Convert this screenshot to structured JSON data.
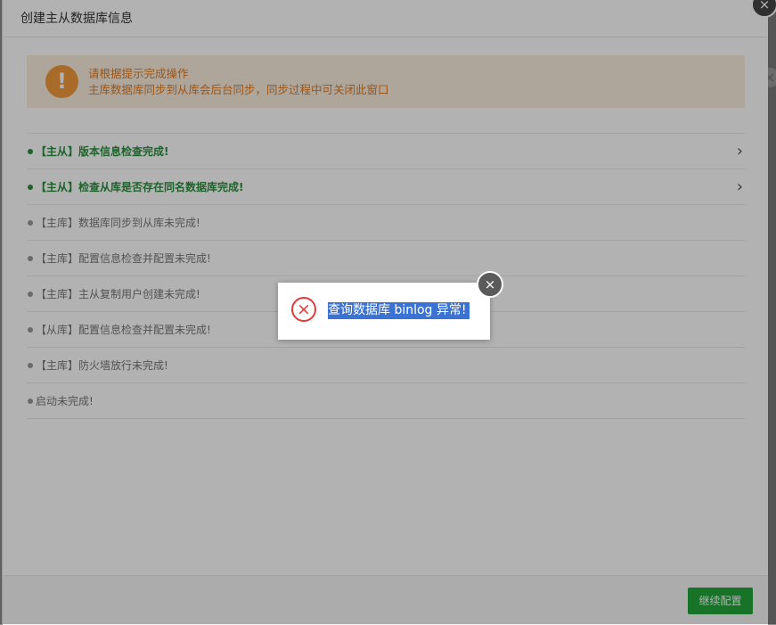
{
  "dialog": {
    "title": "创建主从数据库信息",
    "close_icon": "×"
  },
  "notice": {
    "icon": "!",
    "line1": "请根据提示完成操作",
    "line2": "主库数据库同步到从库会后台同步，同步过程中可关闭此窗口"
  },
  "steps": [
    {
      "text": "【主从】版本信息检查完成!",
      "status": "done",
      "chevron": "›"
    },
    {
      "text": "【主从】检查从库是否存在同名数据库完成!",
      "status": "done",
      "chevron": "›"
    },
    {
      "text": "【主库】数据库同步到从库未完成!",
      "status": "pending"
    },
    {
      "text": "【主库】配置信息检查并配置未完成!",
      "status": "pending"
    },
    {
      "text": "【主库】主从复制用户创建未完成!",
      "status": "pending"
    },
    {
      "text": "【从库】配置信息检查并配置未完成!",
      "status": "pending"
    },
    {
      "text": "【主库】防火墙放行未完成!",
      "status": "pending"
    },
    {
      "text": "启动未完成!",
      "status": "pending"
    }
  ],
  "footer": {
    "continue_label": "继续配置"
  },
  "error_popup": {
    "icon": "×",
    "message": "查询数据库 binlog 异常!",
    "close_icon": "×"
  },
  "colors": {
    "accent": "#20a53a",
    "error": "#e23a3a",
    "warning": "#f39a3c"
  }
}
